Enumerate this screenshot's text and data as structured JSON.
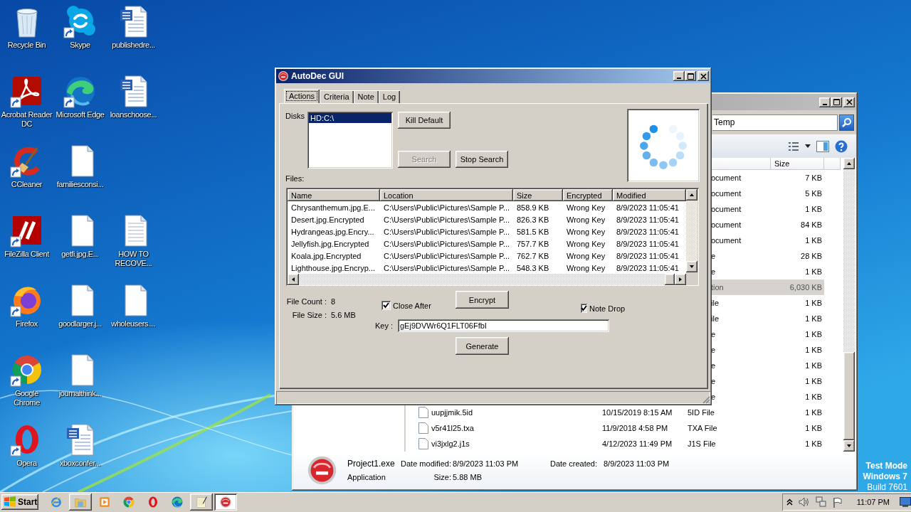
{
  "desktop": {
    "rows": [
      {
        "icons": [
          {
            "label": "Recycle Bin",
            "kind": "recycle-bin",
            "shortcut": false
          },
          {
            "label": "Skype",
            "kind": "skype",
            "shortcut": true
          },
          {
            "label": "publishedre...",
            "kind": "word-doc",
            "shortcut": false
          }
        ]
      },
      {
        "icons": [
          {
            "label": "Acrobat Reader DC",
            "kind": "acrobat",
            "shortcut": true
          },
          {
            "label": "Microsoft Edge",
            "kind": "edge",
            "shortcut": true
          },
          {
            "label": "loanschoose...",
            "kind": "word-doc",
            "shortcut": false
          }
        ]
      },
      {
        "icons": [
          {
            "label": "CCleaner",
            "kind": "ccleaner",
            "shortcut": true
          },
          {
            "label": "familiesconsi...",
            "kind": "blank-file",
            "shortcut": false
          }
        ]
      },
      {
        "icons": [
          {
            "label": "FileZilla Client",
            "kind": "filezilla",
            "shortcut": true
          },
          {
            "label": "getfi.jpg.E...",
            "kind": "blank-file",
            "shortcut": false
          },
          {
            "label": "HOW TO RECOVE...",
            "kind": "text-file",
            "shortcut": false
          }
        ]
      },
      {
        "icons": [
          {
            "label": "Firefox",
            "kind": "firefox",
            "shortcut": true
          },
          {
            "label": "goodlarger.j...",
            "kind": "blank-file",
            "shortcut": false
          },
          {
            "label": "wholeusers....",
            "kind": "blank-file",
            "shortcut": false
          }
        ]
      },
      {
        "icons": [
          {
            "label": "Google Chrome",
            "kind": "chrome",
            "shortcut": true
          },
          {
            "label": "journalthink...",
            "kind": "blank-file",
            "shortcut": false
          }
        ]
      },
      {
        "icons": [
          {
            "label": "Opera",
            "kind": "opera",
            "shortcut": true
          },
          {
            "label": "xboxconfer...",
            "kind": "word-doc",
            "shortcut": false
          }
        ]
      }
    ]
  },
  "explorer": {
    "address": "Temp",
    "columns": [
      "Size"
    ],
    "rows": [
      {
        "type": "ocument",
        "size": "7 KB",
        "selected": false
      },
      {
        "type": "ocument",
        "size": "5 KB",
        "selected": false
      },
      {
        "type": "ocument",
        "size": "1 KB",
        "selected": false
      },
      {
        "type": "ocument",
        "size": "84 KB",
        "selected": false
      },
      {
        "type": "ocument",
        "size": "1 KB",
        "selected": false
      },
      {
        "type": "e",
        "size": "28 KB",
        "selected": false
      },
      {
        "type": "e",
        "size": "1 KB",
        "selected": false
      },
      {
        "type": "tion",
        "size": "6,030 KB",
        "selected": true
      },
      {
        "type": "ile",
        "size": "1 KB",
        "selected": false
      },
      {
        "type": "ile",
        "size": "1 KB",
        "selected": false
      },
      {
        "type": "e",
        "size": "1 KB",
        "selected": false
      },
      {
        "type": "e",
        "size": "1 KB",
        "selected": false
      },
      {
        "type": "e",
        "size": "1 KB",
        "selected": false
      },
      {
        "type": "e",
        "size": "1 KB",
        "selected": false
      },
      {
        "type": "e",
        "size": "1 KB",
        "selected": false
      }
    ],
    "files": [
      {
        "name": "uupjjmik.5id",
        "modified": "10/15/2019 8:15 AM",
        "type": "5ID File",
        "size": "1 KB"
      },
      {
        "name": "v5r41l25.txa",
        "modified": "11/9/2018 4:58 PM",
        "type": "TXA File",
        "size": "1 KB"
      },
      {
        "name": "vi3jxlg2.j1s",
        "modified": "4/12/2023 11:49 PM",
        "type": "J1S File",
        "size": "1 KB"
      }
    ],
    "details": {
      "name": "Project1.exe",
      "type": "Application",
      "modified_label": "Date modified:",
      "modified": "8/9/2023 11:03 PM",
      "created_label": "Date created:",
      "created": "8/9/2023 11:03 PM",
      "size_label": "Size:",
      "size": "5.88 MB"
    }
  },
  "autodec": {
    "title": "AutoDec GUI",
    "tabs": [
      {
        "label": "Actions",
        "selected": true
      },
      {
        "label": "Criteria",
        "selected": false
      },
      {
        "label": "Note",
        "selected": false
      },
      {
        "label": "Log",
        "selected": false
      }
    ],
    "disks_label": "Disks",
    "disks": [
      {
        "label": "HD:C:\\",
        "selected": true
      }
    ],
    "buttons": [
      {
        "label": "Kill Default",
        "disabled": false
      },
      {
        "label": "Search",
        "disabled": true
      },
      {
        "label": "Stop Search",
        "disabled": false
      }
    ],
    "files_label": "Files:",
    "columns": [
      "Name",
      "Location",
      "Size",
      "Encrypted",
      "Modified"
    ],
    "files": [
      {
        "name": "Chrysanthemum.jpg.E...",
        "location": "C:\\Users\\Public\\Pictures\\Sample P...",
        "size": "858.9 KB",
        "encrypted": "Wrong Key",
        "modified": "8/9/2023 11:05:41"
      },
      {
        "name": "Desert.jpg.Encrypted",
        "location": "C:\\Users\\Public\\Pictures\\Sample P...",
        "size": "826.3 KB",
        "encrypted": "Wrong Key",
        "modified": "8/9/2023 11:05:41"
      },
      {
        "name": "Hydrangeas.jpg.Encry...",
        "location": "C:\\Users\\Public\\Pictures\\Sample P...",
        "size": "581.5 KB",
        "encrypted": "Wrong Key",
        "modified": "8/9/2023 11:05:41"
      },
      {
        "name": "Jellyfish.jpg.Encrypted",
        "location": "C:\\Users\\Public\\Pictures\\Sample P...",
        "size": "757.7 KB",
        "encrypted": "Wrong Key",
        "modified": "8/9/2023 11:05:41"
      },
      {
        "name": "Koala.jpg.Encrypted",
        "location": "C:\\Users\\Public\\Pictures\\Sample P...",
        "size": "762.7 KB",
        "encrypted": "Wrong Key",
        "modified": "8/9/2023 11:05:41"
      },
      {
        "name": "Lighthouse.jpg.Encryp...",
        "location": "C:\\Users\\Public\\Pictures\\Sample P...",
        "size": "548.3 KB",
        "encrypted": "Wrong Key",
        "modified": "8/9/2023 11:05:41"
      }
    ],
    "file_count_label": "File Count :",
    "file_count": "8",
    "file_size_label": "File Size :",
    "file_size": "5.6 MB",
    "close_after": {
      "label": "Close After",
      "checked": true
    },
    "encrypt_button": "Encrypt",
    "note_drop": {
      "label": "Note Drop",
      "checked": true
    },
    "key_label": "Key :",
    "key": "gEj9DVWr6Q1FLT06FfbI",
    "generate_button": "Generate"
  },
  "test_mode": [
    "Test Mode",
    "Windows 7",
    "Build 7601"
  ],
  "taskbar": {
    "start": "Start",
    "apps": [
      {
        "kind": "ie",
        "window": false,
        "active": false
      },
      {
        "kind": "folder",
        "window": true,
        "active": false
      },
      {
        "kind": "media",
        "window": false,
        "active": false
      },
      {
        "kind": "chrome",
        "window": false,
        "active": false
      },
      {
        "kind": "opera",
        "window": false,
        "active": false
      },
      {
        "kind": "edge",
        "window": false,
        "active": false
      },
      {
        "kind": "notepad",
        "window": true,
        "active": false
      },
      {
        "kind": "dx",
        "window": true,
        "active": true
      }
    ],
    "clock": "11:07 PM"
  }
}
